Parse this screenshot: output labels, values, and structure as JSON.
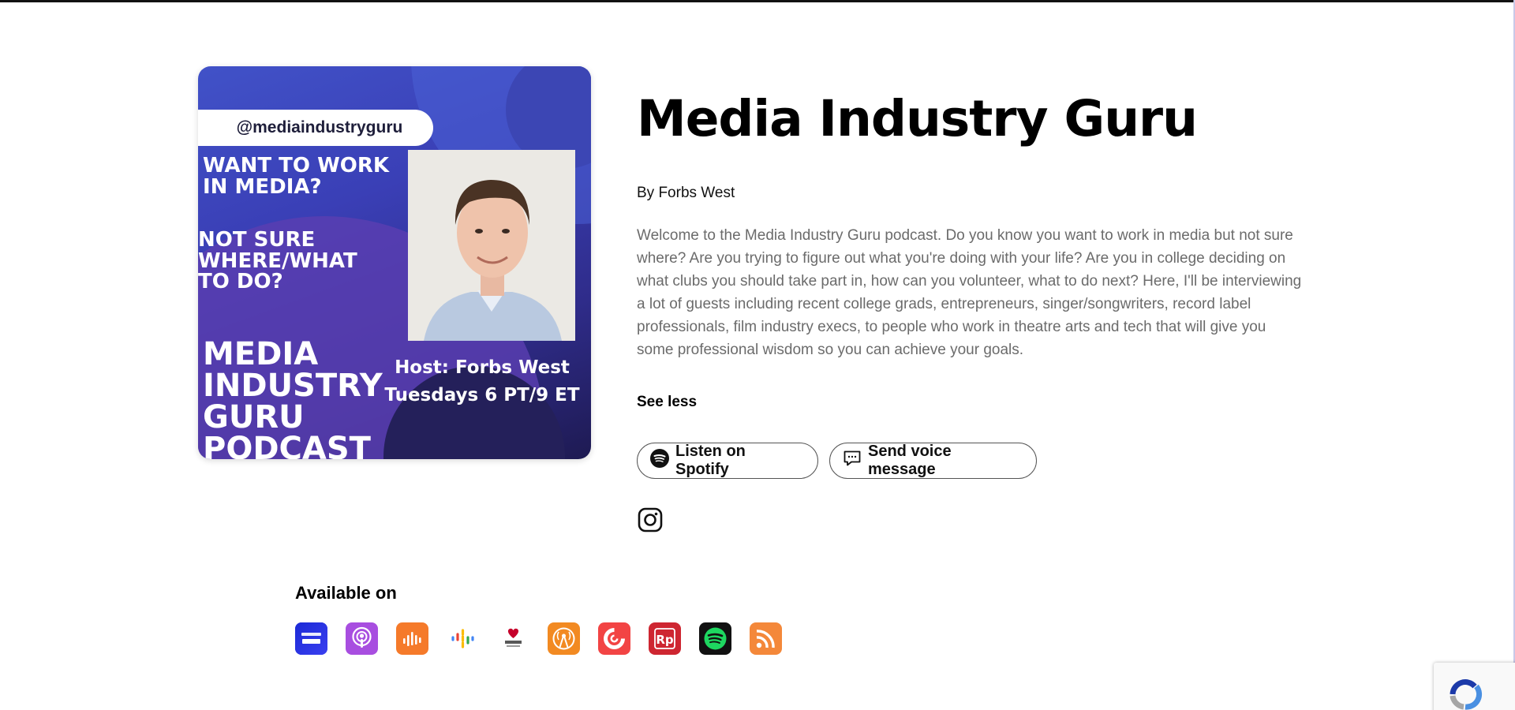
{
  "cover": {
    "handle": "@mediaindustryguru",
    "question1": "WANT TO WORK\nIN MEDIA?",
    "question2": "NOT SURE\nWHERE/WHAT\nTO DO?",
    "brand": "MEDIA\nINDUSTRY\nGURU\nPODCAST",
    "host": "Host: Forbs West\nTuesdays 6 PT/9 ET"
  },
  "podcast": {
    "title": "Media Industry Guru",
    "author": "By Forbs West",
    "description": "Welcome to the Media Industry Guru podcast. Do you know you want to work in media but not sure where? Are you trying to figure out what you're doing with your life? Are you in college deciding on what clubs you should take part in, how can you volunteer, what to do next? Here, I'll be interviewing a lot of guests including recent college grads, entrepreneurs, singer/songwriters, record label professionals, film industry execs, to people who work in theatre arts and tech that will give you some professional wisdom so you can achieve your goals.",
    "see_less": "See less"
  },
  "actions": {
    "spotify_label": "Listen on Spotify",
    "voice_label": "Send voice message"
  },
  "available": {
    "heading": "Available on",
    "platforms": [
      {
        "name": "Amazon Music",
        "icon": "amazon-music-icon",
        "color": "#2a2fd6"
      },
      {
        "name": "Apple Podcasts",
        "icon": "apple-podcasts-icon",
        "color": "#a84ee0"
      },
      {
        "name": "Castbox",
        "icon": "castbox-icon",
        "color": "#f57a2a"
      },
      {
        "name": "Google Podcasts",
        "icon": "google-podcasts-icon",
        "color": "#ffffff"
      },
      {
        "name": "iHeartRadio",
        "icon": "iheartradio-icon",
        "color": "#ffffff"
      },
      {
        "name": "Overcast",
        "icon": "overcast-icon",
        "color": "#f28a22"
      },
      {
        "name": "Pocket Casts",
        "icon": "pocket-casts-icon",
        "color": "#f24444"
      },
      {
        "name": "RadioPublic",
        "icon": "radiopublic-icon",
        "color": "#ce2631"
      },
      {
        "name": "Spotify",
        "icon": "spotify-icon",
        "color": "#111111"
      },
      {
        "name": "RSS",
        "icon": "rss-icon",
        "color": "#f4883a"
      }
    ]
  }
}
